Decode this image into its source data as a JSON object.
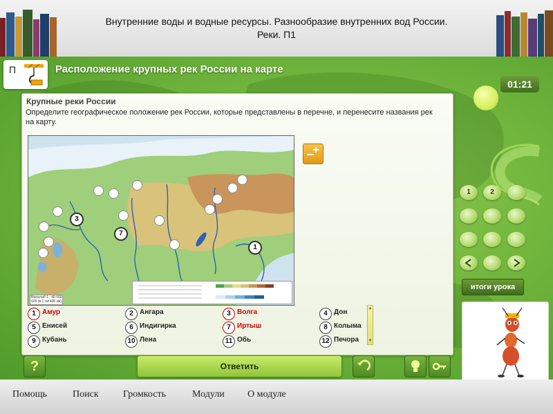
{
  "header": {
    "title_line1": "Внутренние воды и водные ресурсы. Разнообразие внутренних вод России.",
    "title_line2": "Реки. П1"
  },
  "task": {
    "letter": "П",
    "header": "Расположение крупных рек России на карте",
    "icon": "crane-hook-icon"
  },
  "timer": "01:21",
  "panel": {
    "title": "Крупные реки России",
    "instruction": "Определите географическое положение рек России, которые представлены в перечне, и перенесите названия рек на карту."
  },
  "map": {
    "placed_markers": [
      "3",
      "7",
      "1"
    ],
    "empty_slot_count": 14,
    "scale_text": "Масштаб 1 : 40 000 000 (в 1 см 400 км)"
  },
  "rivers": [
    {
      "num": "1",
      "name": "Амур",
      "highlight": true
    },
    {
      "num": "2",
      "name": "Ангара",
      "highlight": false
    },
    {
      "num": "3",
      "name": "Волга",
      "highlight": true
    },
    {
      "num": "4",
      "name": "Дон",
      "highlight": false
    },
    {
      "num": "5",
      "name": "Енисей",
      "highlight": false
    },
    {
      "num": "6",
      "name": "Индигирка",
      "highlight": false
    },
    {
      "num": "7",
      "name": "Иртыш",
      "highlight": true
    },
    {
      "num": "8",
      "name": "Колыма",
      "highlight": false
    },
    {
      "num": "9",
      "name": "Кубань",
      "highlight": false
    },
    {
      "num": "10",
      "name": "Лена",
      "highlight": false
    },
    {
      "num": "11",
      "name": "Обь",
      "highlight": false
    },
    {
      "num": "12",
      "name": "Печора",
      "highlight": false
    }
  ],
  "slides": [
    "1",
    "2"
  ],
  "results_button": "итоги урока",
  "answer_button": "Ответить",
  "help_button": "?",
  "footer_menu": [
    "Помощь",
    "Поиск",
    "Громкость",
    "Модули",
    "О модуле"
  ],
  "colors": {
    "accent_green": "#6cb23a",
    "highlight_red": "#cc0000",
    "answer_button": "#a8d84a"
  }
}
